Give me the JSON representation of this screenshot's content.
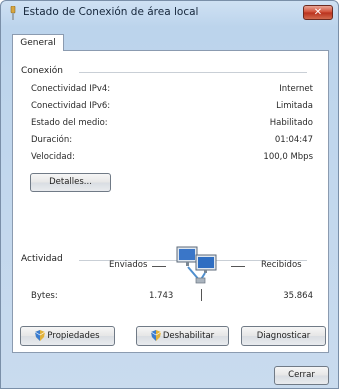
{
  "window": {
    "title": "Estado de Conexión de área local",
    "close_label": "✕"
  },
  "tabs": [
    {
      "label": "General"
    }
  ],
  "connection": {
    "title": "Conexión",
    "rows": [
      {
        "label": "Conectividad IPv4:",
        "value": "Internet"
      },
      {
        "label": "Conectividad IPv6:",
        "value": "Limitada"
      },
      {
        "label": "Estado del medio:",
        "value": "Habilitado"
      },
      {
        "label": "Duración:",
        "value": "01:04:47"
      },
      {
        "label": "Velocidad:",
        "value": "100,0 Mbps"
      }
    ],
    "details_label": "Detalles..."
  },
  "activity": {
    "title": "Actividad",
    "sent_label": "Enviados",
    "received_label": "Recibidos",
    "bytes_label": "Bytes:",
    "bytes_sent": "1.743",
    "bytes_received": "35.864"
  },
  "buttons": {
    "properties": "Propiedades",
    "disable": "Deshabilitar",
    "diagnose": "Diagnosticar",
    "close": "Cerrar"
  },
  "icons": {
    "title": "network-plug-icon",
    "network": "network-computers-icon",
    "shield": "uac-shield-icon"
  }
}
